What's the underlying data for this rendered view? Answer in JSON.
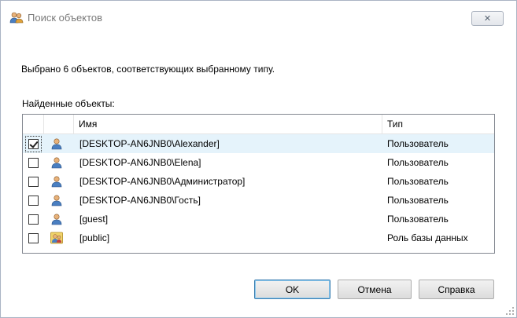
{
  "window": {
    "title": "Поиск объектов",
    "close_glyph": "✕"
  },
  "message": "Выбрано 6 объектов, соответствующих выбранному типу.",
  "found_label": "Найденные объекты:",
  "columns": {
    "name": "Имя",
    "type": "Тип"
  },
  "rows": [
    {
      "name": "[DESKTOP-AN6JNB0\\Alexander]",
      "type": "Пользователь",
      "checked": true,
      "icon": "user-icon"
    },
    {
      "name": "[DESKTOP-AN6JNB0\\Elena]",
      "type": "Пользователь",
      "checked": false,
      "icon": "user-icon"
    },
    {
      "name": "[DESKTOP-AN6JNB0\\Администратор]",
      "type": "Пользователь",
      "checked": false,
      "icon": "user-icon"
    },
    {
      "name": "[DESKTOP-AN6JNB0\\Гость]",
      "type": "Пользователь",
      "checked": false,
      "icon": "user-icon"
    },
    {
      "name": "[guest]",
      "type": "Пользователь",
      "checked": false,
      "icon": "user-icon"
    },
    {
      "name": "[public]",
      "type": "Роль базы данных",
      "checked": false,
      "icon": "database-role-icon"
    }
  ],
  "buttons": {
    "ok": "OK",
    "cancel": "Отмена",
    "help": "Справка"
  }
}
